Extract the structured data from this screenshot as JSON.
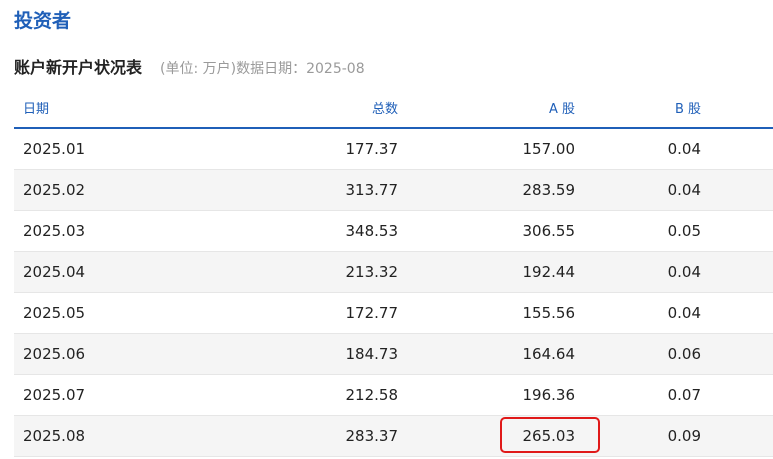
{
  "section_title": "投资者",
  "table_title": "账户新开户状况表",
  "table_note": "(单位: 万户)数据日期：2025-08",
  "columns": [
    "日期",
    "总数",
    "A 股",
    "B 股"
  ],
  "rows": [
    [
      "2025.01",
      "177.37",
      "157.00",
      "0.04"
    ],
    [
      "2025.02",
      "313.77",
      "283.59",
      "0.04"
    ],
    [
      "2025.03",
      "348.53",
      "306.55",
      "0.05"
    ],
    [
      "2025.04",
      "213.32",
      "192.44",
      "0.04"
    ],
    [
      "2025.05",
      "172.77",
      "155.56",
      "0.04"
    ],
    [
      "2025.06",
      "184.73",
      "164.64",
      "0.06"
    ],
    [
      "2025.07",
      "212.58",
      "196.36",
      "0.07"
    ],
    [
      "2025.08",
      "283.37",
      "265.03",
      "0.09"
    ]
  ],
  "colors": {
    "accent": "#1f5fb8",
    "highlight": "#e01919",
    "row_alt": "#f5f5f5"
  }
}
